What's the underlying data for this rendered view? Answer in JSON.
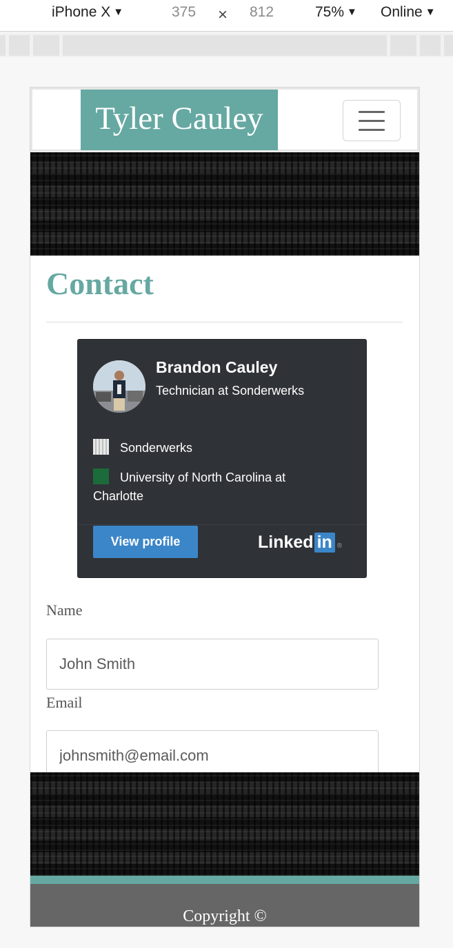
{
  "devtools": {
    "device": "iPhone X",
    "width": "375",
    "times": "×",
    "height": "812",
    "zoom": "75%",
    "network": "Online",
    "caret": "▼"
  },
  "navbar": {
    "brand": "Tyler Cauley",
    "toggler_icon": "hamburger-menu-icon"
  },
  "page": {
    "title": "Contact"
  },
  "linkedin_badge": {
    "name": "Brandon Cauley",
    "headline": "Technician at Sonderwerks",
    "company": "Sonderwerks",
    "school": "University of North Carolina at Charlotte",
    "view_profile": "View profile",
    "logo_text": "Linked",
    "logo_in": "in",
    "logo_mark": "®"
  },
  "form": {
    "name_label": "Name",
    "name_placeholder": "John Smith",
    "email_label": "Email",
    "email_placeholder": "johnsmith@email.com"
  },
  "footer": {
    "copyright": "Copyright ©"
  },
  "colors": {
    "accent": "#66a8a2",
    "badge_bg": "#2f3237",
    "linkedin_blue": "#3b86c8",
    "footer_bg": "#666666"
  }
}
